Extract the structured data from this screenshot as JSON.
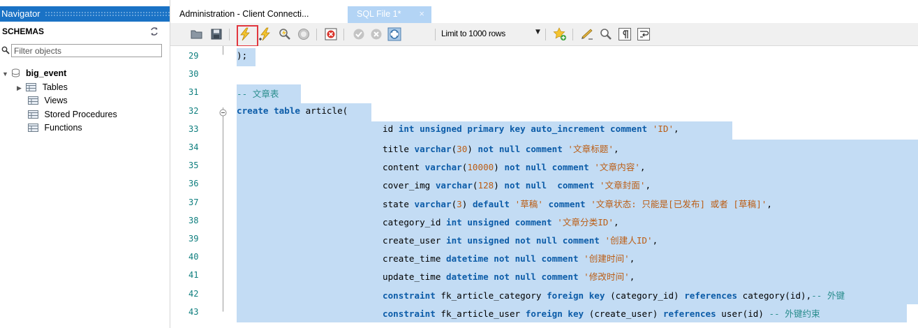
{
  "navigator": {
    "title": "Navigator",
    "section": "SCHEMAS",
    "filter_placeholder": "Filter objects",
    "schema_name": "big_event",
    "tree": [
      {
        "label": "Tables",
        "expandable": true
      },
      {
        "label": "Views",
        "expandable": false
      },
      {
        "label": "Stored Procedures",
        "expandable": false
      },
      {
        "label": "Functions",
        "expandable": false
      }
    ]
  },
  "tabs": [
    {
      "label": "Administration - Client Connecti...",
      "active": false
    },
    {
      "label": "SQL File 1*",
      "active": true,
      "close": "×"
    }
  ],
  "toolbar": {
    "limit_label": "Limit to 1000 rows",
    "icons": [
      "open-file-icon",
      "save-icon",
      "execute-icon",
      "execute-statement-icon",
      "explain-icon",
      "stop-icon",
      "toggle-error-icon",
      "commit-icon",
      "rollback-icon",
      "autocommit-icon",
      "limit-dropdown",
      "add-snippet-icon",
      "beautify-icon",
      "find-icon",
      "invisible-chars-icon",
      "wrap-icon"
    ]
  },
  "editor": {
    "lines": [
      {
        "n": "29",
        "tokens": [
          [
            "pn",
            ");"
          ]
        ]
      },
      {
        "n": "30",
        "tokens": []
      },
      {
        "n": "31",
        "tokens": [
          [
            "cm",
            "-- 文章表"
          ]
        ]
      },
      {
        "n": "32",
        "tokens": [
          [
            "kw",
            "create table "
          ],
          [
            "tx",
            "article("
          ]
        ]
      },
      {
        "n": "33",
        "tokens": [
          [
            "tx",
            "id "
          ],
          [
            "kw",
            "int unsigned primary key auto_increment comment "
          ],
          [
            "str",
            "'ID'"
          ],
          [
            "pn",
            ","
          ]
        ]
      },
      {
        "n": "34",
        "tokens": [
          [
            "tx",
            "title "
          ],
          [
            "kw",
            "varchar"
          ],
          [
            "pn",
            "("
          ],
          [
            "num",
            "30"
          ],
          [
            "pn",
            ") "
          ],
          [
            "kw",
            "not null comment "
          ],
          [
            "str",
            "'文章标题'"
          ],
          [
            "pn",
            ","
          ]
        ]
      },
      {
        "n": "35",
        "tokens": [
          [
            "tx",
            "content "
          ],
          [
            "kw",
            "varchar"
          ],
          [
            "pn",
            "("
          ],
          [
            "num",
            "10000"
          ],
          [
            "pn",
            ") "
          ],
          [
            "kw",
            "not null comment "
          ],
          [
            "str",
            "'文章内容'"
          ],
          [
            "pn",
            ","
          ]
        ]
      },
      {
        "n": "36",
        "tokens": [
          [
            "tx",
            "cover_img "
          ],
          [
            "kw",
            "varchar"
          ],
          [
            "pn",
            "("
          ],
          [
            "num",
            "128"
          ],
          [
            "pn",
            ") "
          ],
          [
            "kw",
            "not null  comment "
          ],
          [
            "str",
            "'文章封面'"
          ],
          [
            "pn",
            ","
          ]
        ]
      },
      {
        "n": "37",
        "tokens": [
          [
            "tx",
            "state "
          ],
          [
            "kw",
            "varchar"
          ],
          [
            "pn",
            "("
          ],
          [
            "num",
            "3"
          ],
          [
            "pn",
            ") "
          ],
          [
            "kw",
            "default "
          ],
          [
            "str",
            "'草稿'"
          ],
          [
            "kw",
            " comment "
          ],
          [
            "str",
            "'文章状态: 只能是[已发布] 或者 [草稿]'"
          ],
          [
            "pn",
            ","
          ]
        ]
      },
      {
        "n": "38",
        "tokens": [
          [
            "tx",
            "category_id "
          ],
          [
            "kw",
            "int unsigned comment "
          ],
          [
            "str",
            "'文章分类ID'"
          ],
          [
            "pn",
            ","
          ]
        ]
      },
      {
        "n": "39",
        "tokens": [
          [
            "tx",
            "create_user "
          ],
          [
            "kw",
            "int unsigned not null comment "
          ],
          [
            "str",
            "'创建人ID'"
          ],
          [
            "pn",
            ","
          ]
        ]
      },
      {
        "n": "40",
        "tokens": [
          [
            "tx",
            "create_time "
          ],
          [
            "kw",
            "datetime not null comment "
          ],
          [
            "str",
            "'创建时间'"
          ],
          [
            "pn",
            ","
          ]
        ]
      },
      {
        "n": "41",
        "tokens": [
          [
            "tx",
            "update_time "
          ],
          [
            "kw",
            "datetime not null comment "
          ],
          [
            "str",
            "'修改时间'"
          ],
          [
            "pn",
            ","
          ]
        ]
      },
      {
        "n": "42",
        "tokens": [
          [
            "kw",
            "constraint "
          ],
          [
            "tx",
            "fk_article_category "
          ],
          [
            "kw",
            "foreign key "
          ],
          [
            "pn",
            "(category_id) "
          ],
          [
            "kw",
            "references "
          ],
          [
            "tx",
            "category(id),"
          ],
          [
            "cm",
            "-- 外键"
          ]
        ]
      },
      {
        "n": "43",
        "tokens": [
          [
            "kw",
            "constraint "
          ],
          [
            "tx",
            "fk_article_user "
          ],
          [
            "kw",
            "foreign key "
          ],
          [
            "pn",
            "(create_user) "
          ],
          [
            "kw",
            "references "
          ],
          [
            "tx",
            "user(id) "
          ],
          [
            "cm",
            "-- 外键约束"
          ]
        ]
      }
    ]
  },
  "colors": {
    "nav_header": "#1a72c5",
    "active_tab": "#b3d4f5",
    "selection": "#c3dcf4",
    "keyword": "#0c5ca8",
    "string": "#bb5d14",
    "comment": "#2a8d8d",
    "line_number": "#0e7e7e",
    "highlight_box": "#e2373f"
  }
}
